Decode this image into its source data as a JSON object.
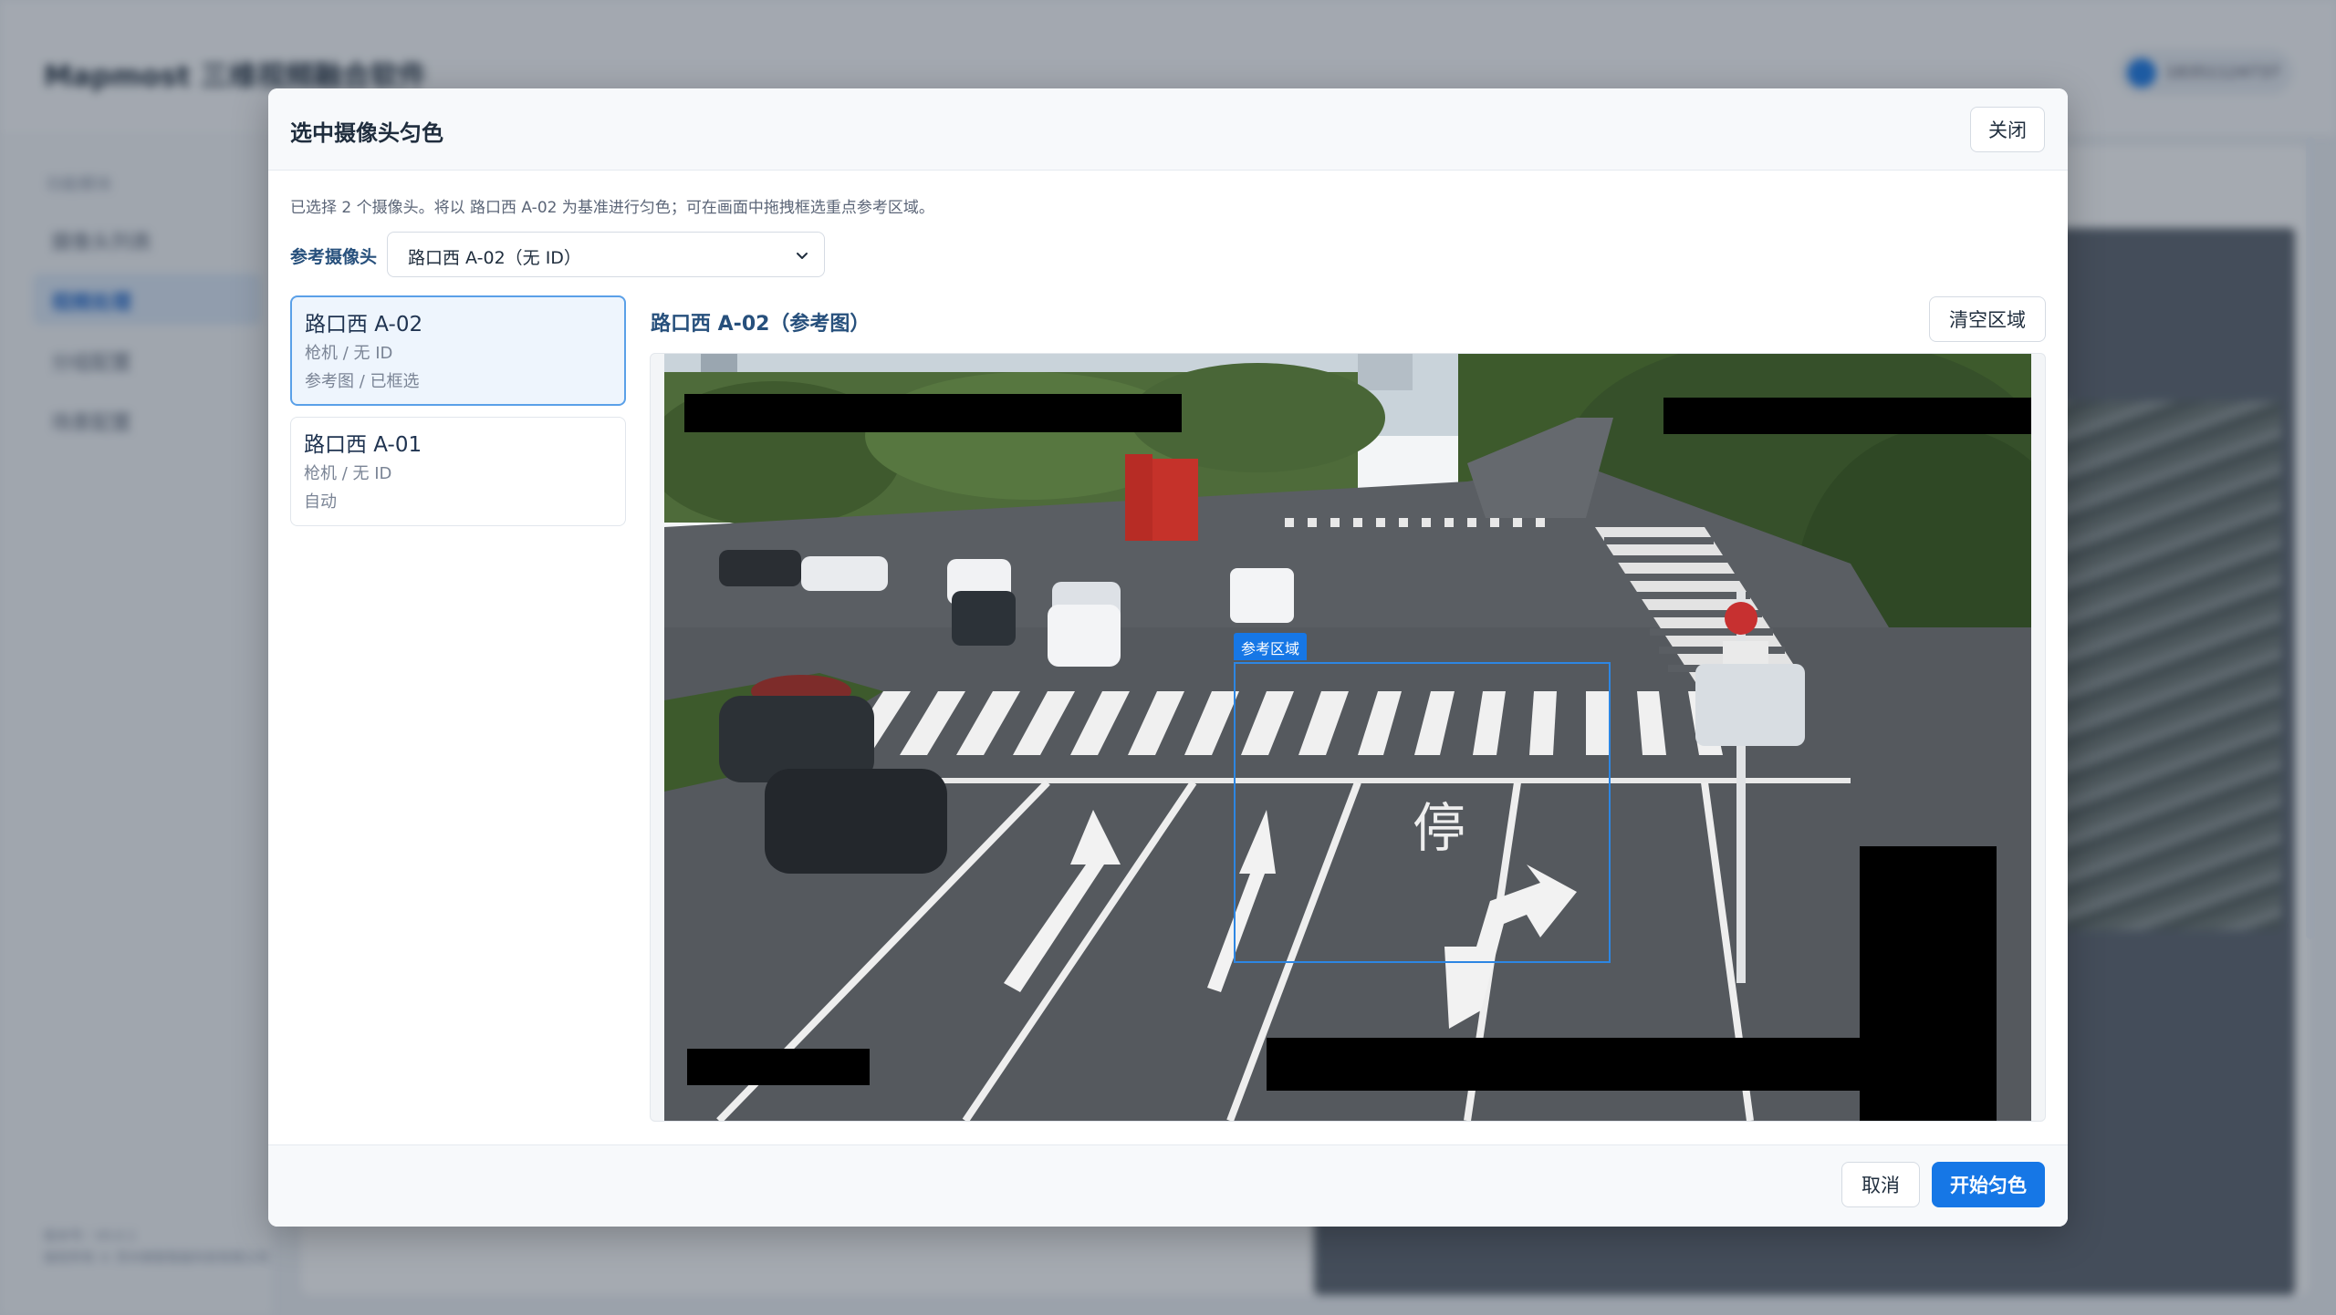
{
  "background": {
    "app_title": "Mapmost 三维视频融合软件",
    "user_name": "18351124737",
    "sidebar_label": "功能模块",
    "sidebar_items": [
      "摄像头列表",
      "视频处理",
      "分组配置",
      "场景配置"
    ],
    "sidebar_active_index": 1,
    "footer_lines": [
      "版本号：V0.0.1",
      "版权所有 © 苏州南智智能科技有限公司"
    ]
  },
  "dialog": {
    "title": "选中摄像头匀色",
    "close_label": "关闭",
    "info": "已选择 2 个摄像头。将以 路口西 A-02 为基准进行匀色；可在画面中拖拽框选重点参考区域。",
    "reference_label": "参考摄像头",
    "reference_select_value": "路口西 A-02（无 ID）",
    "chevron_icon": "chevron-down-icon",
    "cameras": [
      {
        "name": "路口西 A-02",
        "meta": "枪机 / 无 ID",
        "status": "参考图 / 已框选",
        "selected": true
      },
      {
        "name": "路口西 A-01",
        "meta": "枪机 / 无 ID",
        "status": "自动",
        "selected": false
      }
    ],
    "preview_title": "路口西 A-02（参考图）",
    "clear_label": "清空区域",
    "roi_label": "参考区域",
    "stop_marking": "停",
    "cancel_label": "取消",
    "start_label": "开始匀色",
    "accent_color": "#1677e6"
  }
}
